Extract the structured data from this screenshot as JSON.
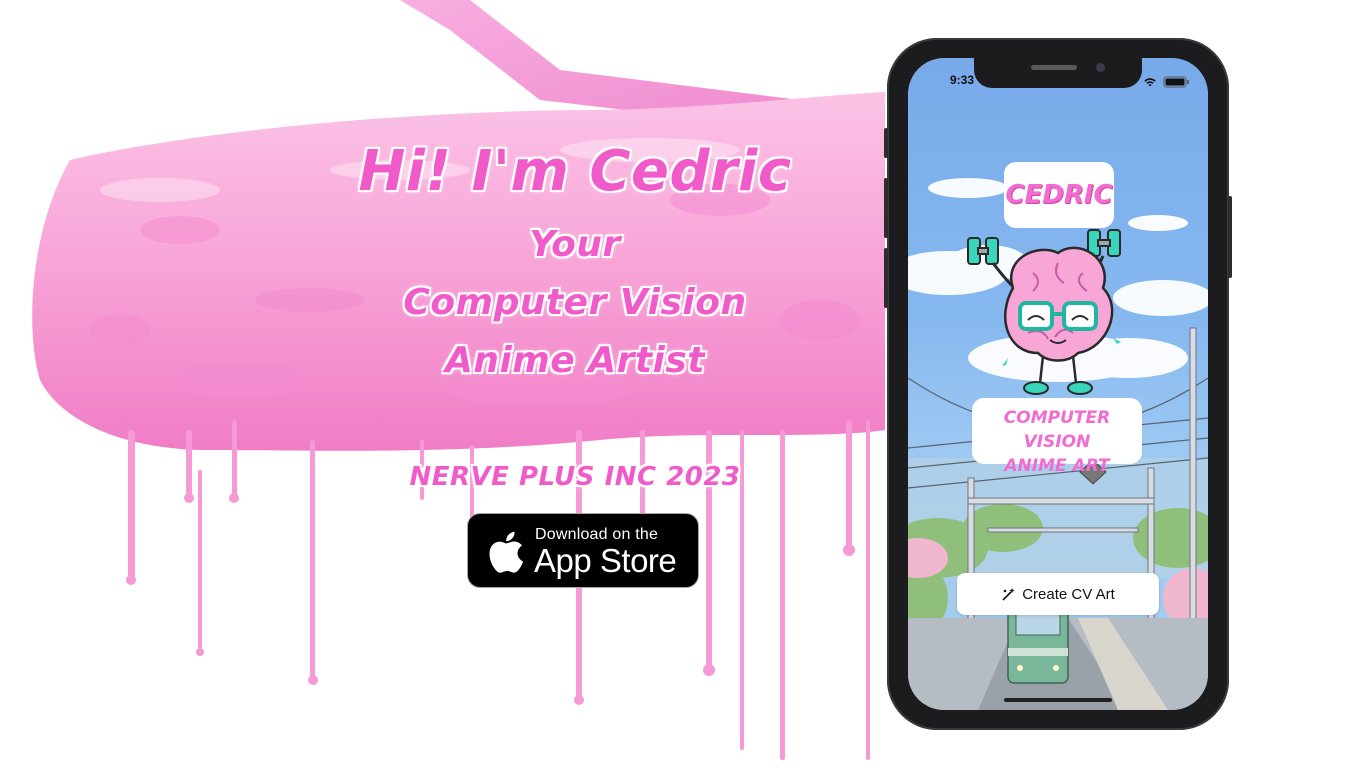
{
  "headline": {
    "title": "Hi! I'm Cedric",
    "line1": "Your",
    "line2": "Computer Vision",
    "line3": "Anime Artist",
    "company": "NERVE PLUS INC 2023"
  },
  "app_store": {
    "line1": "Download on the",
    "line2": "App Store"
  },
  "phone": {
    "status_time": "9:33",
    "app_title": "CEDRIC",
    "app_subtitle_line1": "COMPUTER VISION",
    "app_subtitle_line2": "ANIME ART",
    "cta_label": "Create CV Art"
  },
  "colors": {
    "accent_pink": "#f05bc9",
    "paint_pink": "#f7a3d6",
    "sky_blue": "#7fb0ec",
    "brain_teal": "#2fd3b8"
  },
  "icons": [
    "apple-icon",
    "magic-wand-icon",
    "signal-icon",
    "wifi-icon",
    "battery-icon"
  ]
}
